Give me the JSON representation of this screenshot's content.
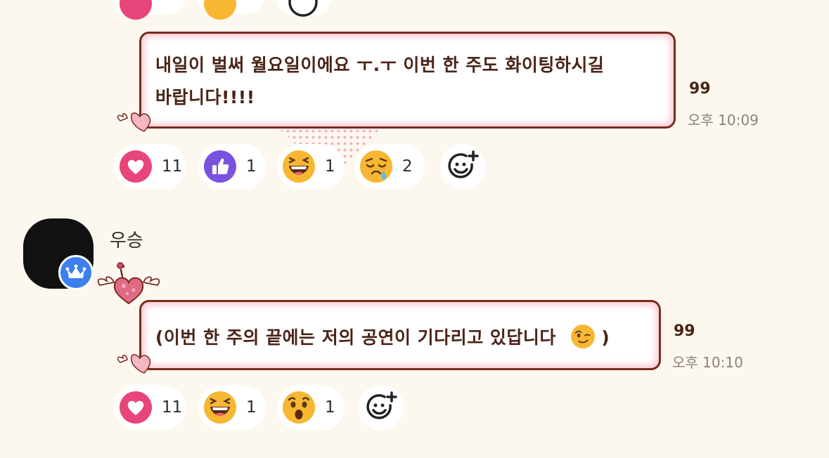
{
  "messages": [
    {
      "text_line1": "내일이 벌써 월요일이에요 ㅜ.ㅜ 이번 한 주도 화이팅하시길",
      "text_line2": "바랍니다!!!!",
      "read_count": "99",
      "time": "오후 10:09",
      "reactions": [
        {
          "icon": "heart-icon",
          "count": "11",
          "color": "#e8457a"
        },
        {
          "icon": "thumbs-up-icon",
          "count": "1",
          "color": "#7b52e0"
        },
        {
          "icon": "laughing-face-icon",
          "count": "1",
          "color": "#f7b733"
        },
        {
          "icon": "crying-face-icon",
          "count": "2",
          "color": "#f7b733"
        }
      ]
    },
    {
      "author": "우승",
      "text_line1": "(이번 한 주의 끝에는 저의 공연이 기다리고 있답니다",
      "text_tail": ")",
      "read_count": "99",
      "time": "오후 10:10",
      "reactions": [
        {
          "icon": "heart-icon",
          "count": "11",
          "color": "#e8457a"
        },
        {
          "icon": "laughing-face-icon",
          "count": "1",
          "color": "#f7b733"
        },
        {
          "icon": "surprised-face-icon",
          "count": "1",
          "color": "#f7b733"
        }
      ]
    }
  ],
  "colors": {
    "background": "#fdf8ef",
    "bubble_border": "#7a2a1e",
    "bubble_glow": "#f7c6cf",
    "badge": "#3b7ff0"
  }
}
